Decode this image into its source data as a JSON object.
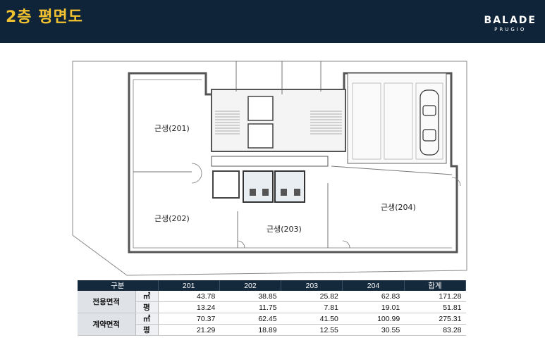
{
  "header": {
    "title": "2층 평면도",
    "brand_main": "BALADE",
    "brand_sub": "PRUGIO",
    "background": "#0f2438",
    "title_color": "#f2c230"
  },
  "plan": {
    "rooms": {
      "r201": "근생(201)",
      "r202": "근생(202)",
      "r203": "근생(203)",
      "r204": "근생(204)"
    }
  },
  "area_table": {
    "headers": [
      "구분",
      "201",
      "202",
      "203",
      "204",
      "합계"
    ],
    "groups": [
      {
        "label": "전용면적",
        "rows": [
          {
            "unit": "㎡",
            "values": [
              "43.78",
              "38.85",
              "25.82",
              "62.83",
              "171.28"
            ]
          },
          {
            "unit": "평",
            "values": [
              "13.24",
              "11.75",
              "7.81",
              "19.01",
              "51.81"
            ]
          }
        ]
      },
      {
        "label": "계약면적",
        "rows": [
          {
            "unit": "㎡",
            "values": [
              "70.37",
              "62.45",
              "41.50",
              "100.99",
              "275.31"
            ]
          },
          {
            "unit": "평",
            "values": [
              "21.29",
              "18.89",
              "12.55",
              "30.55",
              "83.28"
            ]
          }
        ]
      }
    ]
  }
}
